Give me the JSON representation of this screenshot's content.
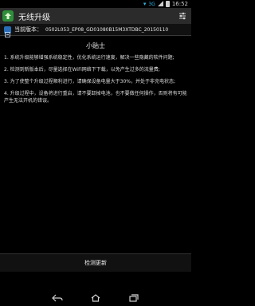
{
  "status_bar": {
    "network": "3G",
    "time": "16:52"
  },
  "app_bar": {
    "title": "无线升级",
    "icon": "upgrade-arrow-icon",
    "menu_icon": "settings-sliders-icon"
  },
  "version": {
    "label": "当前版本：",
    "value": "0502L053_EP08_GD01080B15M3XTDBC_20150110"
  },
  "tips": {
    "title": "小贴士",
    "items": [
      "1. 系统升级能够增强系统稳定性，优化系统运行速度，解决一些隐藏的软件问题;",
      "2. 检测到新版本后，尽量选择在WiFi网络下下载，以免产生过多的流量费;",
      "3. 为了使整个升级过程顺利进行，请确保设备电量大于30%，并处于非充电状态;",
      "4. 升级过程中，设备将进行重启，请不要卸掉电池，也不要做任何操作，否则将有可能产生无法开机的错误。"
    ]
  },
  "check_button": {
    "label": "检测更新"
  },
  "nav_bar": {
    "back_icon": "back-icon",
    "home_icon": "home-icon",
    "recents_icon": "recents-icon"
  },
  "colors": {
    "app_bar_bg": "#2b2b2b",
    "accent_blue": "#33b5e5",
    "app_icon_green": "#2f8f3a"
  }
}
